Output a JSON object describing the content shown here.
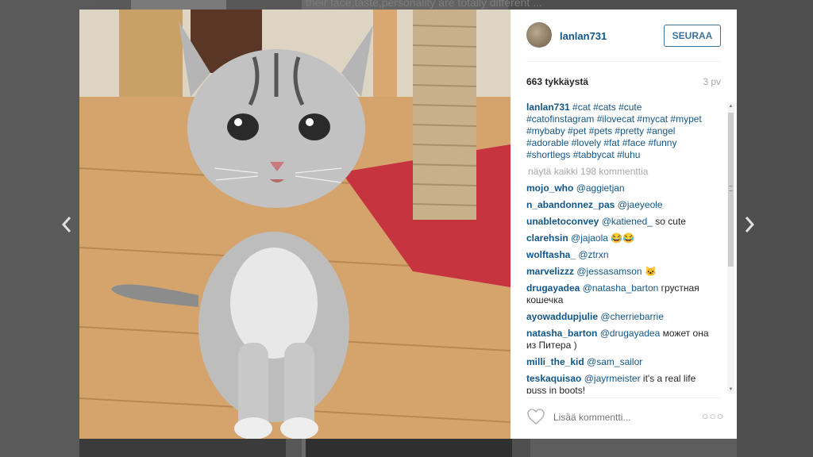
{
  "background": {
    "caption": "their face,taste,personality are totally different ..."
  },
  "post": {
    "username": "lanlan731",
    "follow_label": "SEURAA",
    "likes": "663 tykkäystä",
    "age": "3 pv",
    "caption_user": "lanlan731",
    "caption_tags": "#cat #cats #cute #catofinstagram #ilovecat #mycat #mypet #mybaby #pet #pets #pretty #angel #adorable #lovely #fat #face #funny #shortlegs #tabbycat #luhu",
    "view_all": "näytä kaikki 198 kommenttia",
    "comments": [
      {
        "user": "mojo_who",
        "mention": "@aggietjan",
        "text": ""
      },
      {
        "user": "n_abandonnez_pas",
        "mention": "@jaeyeole",
        "text": ""
      },
      {
        "user": "unabletoconvey",
        "mention": "@katiened_",
        "text": "so cute"
      },
      {
        "user": "clarehsin",
        "mention": "@jajaola",
        "text": "😂😂"
      },
      {
        "user": "wolftasha_",
        "mention": "@ztrxn",
        "text": ""
      },
      {
        "user": "marvelizzz",
        "mention": "@jessasamson",
        "text": "🐱"
      },
      {
        "user": "drugayadea",
        "mention": "@natasha_barton",
        "text": "грустная кошечка"
      },
      {
        "user": "ayowaddupjulie",
        "mention": "@cherriebarrie",
        "text": ""
      },
      {
        "user": "natasha_barton",
        "mention": "@drugayadea",
        "text": "может она из Питера )"
      },
      {
        "user": "milli_the_kid",
        "mention": "@sam_sailor",
        "text": ""
      },
      {
        "user": "teskaquisao",
        "mention": "@jayrmeister",
        "text": "it's a real life puss in boots!"
      }
    ],
    "add_comment_placeholder": "Lisää kommentti...",
    "more_label": "○○○"
  },
  "icons": {
    "prev": "chevron-left-icon",
    "next": "chevron-right-icon",
    "like": "heart-outline-icon",
    "more": "more-options-icon"
  },
  "colors": {
    "link": "#125688",
    "follow": "#3f729b",
    "muted": "#a5a7aa"
  }
}
